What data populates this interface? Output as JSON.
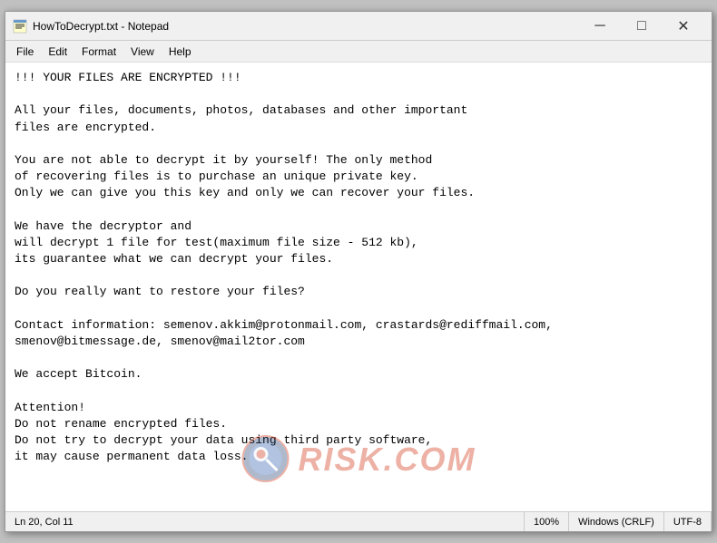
{
  "window": {
    "title": "HowToDecrypt.txt - Notepad",
    "icon": "notepad"
  },
  "titlebar": {
    "minimize_label": "─",
    "maximize_label": "□",
    "close_label": "✕"
  },
  "menubar": {
    "items": [
      {
        "label": "File",
        "id": "file"
      },
      {
        "label": "Edit",
        "id": "edit"
      },
      {
        "label": "Format",
        "id": "format"
      },
      {
        "label": "View",
        "id": "view"
      },
      {
        "label": "Help",
        "id": "help"
      }
    ]
  },
  "content": {
    "text": "!!! YOUR FILES ARE ENCRYPTED !!!\n\nAll your files, documents, photos, databases and other important\nfiles are encrypted.\n\nYou are not able to decrypt it by yourself! The only method\nof recovering files is to purchase an unique private key.\nOnly we can give you this key and only we can recover your files.\n\nWe have the decryptor and\nwill decrypt 1 file for test(maximum file size - 512 kb),\nits guarantee what we can decrypt your files.\n\nDo you really want to restore your files?\n\nContact information: semenov.akkim@protonmail.com, crastards@rediffmail.com,\nsmenov@bitmessage.de, smenov@mail2tor.com\n\nWe accept Bitcoin.\n\nAttention!\nDo not rename encrypted files.\nDo not try to decrypt your data using third party software,\nit may cause permanent data loss."
  },
  "statusbar": {
    "position": "Ln 20, Col 11",
    "zoom": "100%",
    "line_endings": "Windows (CRLF)",
    "encoding": "UTF-8"
  },
  "watermark": {
    "text": "RISK.COM"
  }
}
